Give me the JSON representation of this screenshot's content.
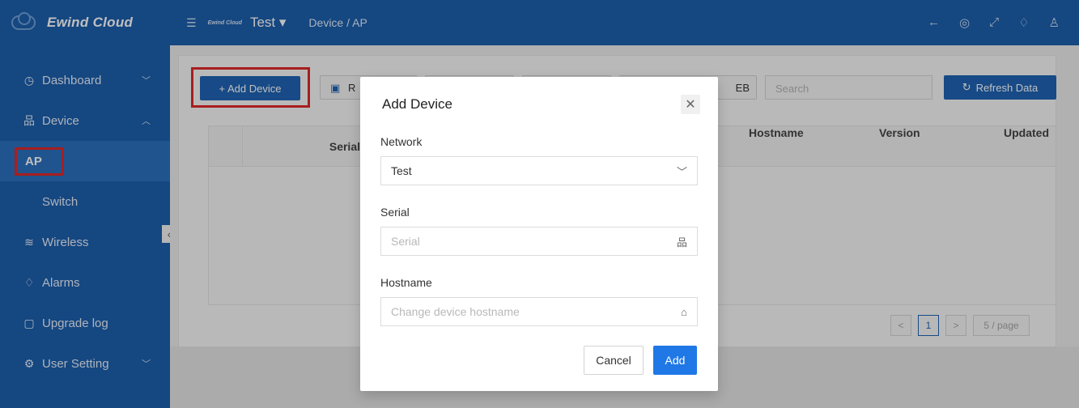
{
  "app": {
    "name": "Ewind Cloud",
    "mini_logo": "Ewind Cloud"
  },
  "topbar": {
    "network": "Test",
    "breadcrumb": "Device / AP"
  },
  "sidebar": {
    "items": [
      {
        "label": "Dashboard",
        "icon": "dashboard-icon"
      },
      {
        "label": "Device",
        "icon": "device-icon"
      },
      {
        "label": "AP",
        "icon": ""
      },
      {
        "label": "Switch",
        "icon": ""
      },
      {
        "label": "Wireless",
        "icon": "wifi-icon"
      },
      {
        "label": "Alarms",
        "icon": "bell-icon"
      },
      {
        "label": "Upgrade log",
        "icon": "file-icon"
      },
      {
        "label": "User Setting",
        "icon": "gear-icon"
      }
    ]
  },
  "toolbar": {
    "add_device": "+ Add Device",
    "partial_1": "R",
    "partial_2": "EB",
    "search_placeholder": "Search",
    "refresh": "Refresh Data"
  },
  "table": {
    "columns": [
      "Serial",
      "Hostname",
      "Version",
      "Updated"
    ]
  },
  "pager": {
    "prev": "<",
    "page": "1",
    "next": ">",
    "size": "5 / page"
  },
  "modal": {
    "title": "Add Device",
    "network_label": "Network",
    "network_value": "Test",
    "serial_label": "Serial",
    "serial_placeholder": "Serial",
    "hostname_label": "Hostname",
    "hostname_placeholder": "Change device hostname",
    "cancel": "Cancel",
    "add": "Add"
  }
}
